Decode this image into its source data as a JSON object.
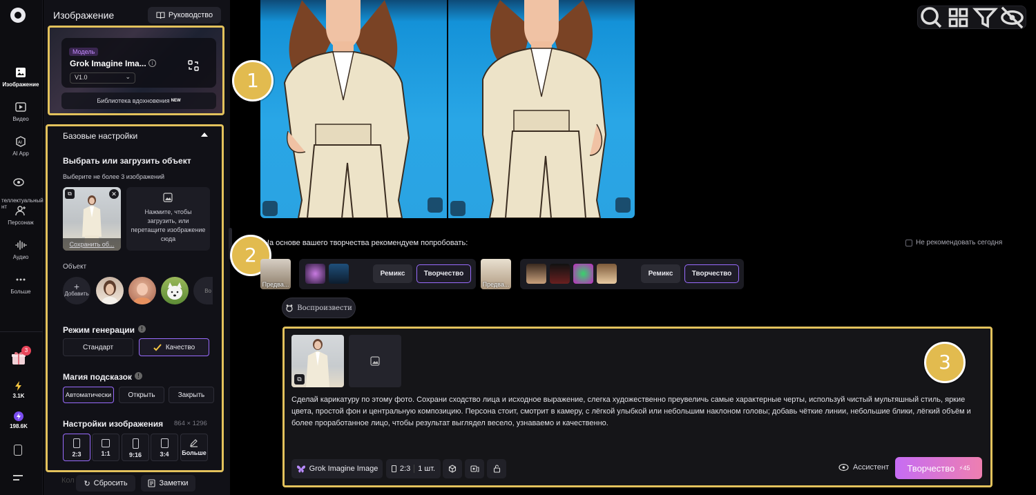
{
  "nav": {
    "items": [
      {
        "label": "Изображение",
        "icon": "image-icon"
      },
      {
        "label": "Видео",
        "icon": "video-icon"
      },
      {
        "label": "AI App",
        "icon": "ai-app-icon"
      },
      {
        "label": "теллектуальный\nнт",
        "icon": "agent-icon"
      },
      {
        "label": "Персонаж",
        "icon": "character-icon"
      },
      {
        "label": "Аудио",
        "icon": "audio-icon"
      },
      {
        "label": "Больше",
        "icon": "more-icon"
      }
    ],
    "gift_badge": "3",
    "stat_energy": "3.1K",
    "stat_credits": "198.6K"
  },
  "panel": {
    "title": "Изображение",
    "guide_label": "Руководство",
    "model": {
      "tag": "Модель",
      "name": "Grok Imagine Ima...",
      "version": "V1.0",
      "inspiration_label": "Библиотека вдохновения",
      "inspiration_badge": "NEW"
    },
    "basic": {
      "header": "Базовые настройки",
      "select_title": "Выбрать или загрузить объект",
      "select_hint": "Выберите не более 3 изображений",
      "save_label": "Сохранить об...",
      "upload_text": "Нажмите, чтобы загрузить, или перетащите изображение сюда",
      "object_label": "Объект",
      "add_label": "Добавить",
      "obj_more": "Во"
    },
    "gen_mode": {
      "title": "Режим генерации",
      "standard": "Стандарт",
      "quality": "Качество"
    },
    "magic": {
      "title": "Магия подсказок",
      "auto": "Автоматически",
      "open": "Открыть",
      "close": "Закрыть"
    },
    "image_settings": {
      "title": "Настройки изображения",
      "size": "864 × 1296",
      "ratios": [
        "2:3",
        "1:1",
        "9:16",
        "3:4"
      ],
      "more": "Больше"
    },
    "footer": {
      "reset": "Сбросить",
      "notes": "Заметки",
      "hidden_label": "Кол"
    }
  },
  "main": {
    "recommend_text": "На основе вашего творчества рекомендуем попробовать:",
    "dont_recommend": "Не рекомендовать сегодня",
    "preview_label": "Предва...",
    "remix_label": "Ремикс",
    "create_label": "Творчество",
    "play_label": "Воспроизвести",
    "prompt": "Сделай карикатуру по этому фото. Сохрани сходство лица и исходное выражение, слегка художественно преувеличь самые характерные черты, используй чистый мультяшный стиль, яркие цвета, простой фон и центральную композицию. Персона стоит, смотрит в камеру, с лёгкой улыбкой или небольшим наклоном головы; добавь чёткие линии, небольшие блики, лёгкий объём и более проработанное лицо, чтобы результат выглядел весело, узнаваемо и качественно.",
    "model_chip": "Grok Imagine Image",
    "ratio_chip": "2:3",
    "count_chip": "1 шт.",
    "assistant": "Ассистент",
    "generate": "Творчество",
    "cost": "45"
  },
  "markers": [
    "1",
    "2",
    "3"
  ],
  "colors": {
    "accent": "#9a6cff",
    "highlight": "#e3c25c",
    "sky": "#29a6e6"
  }
}
